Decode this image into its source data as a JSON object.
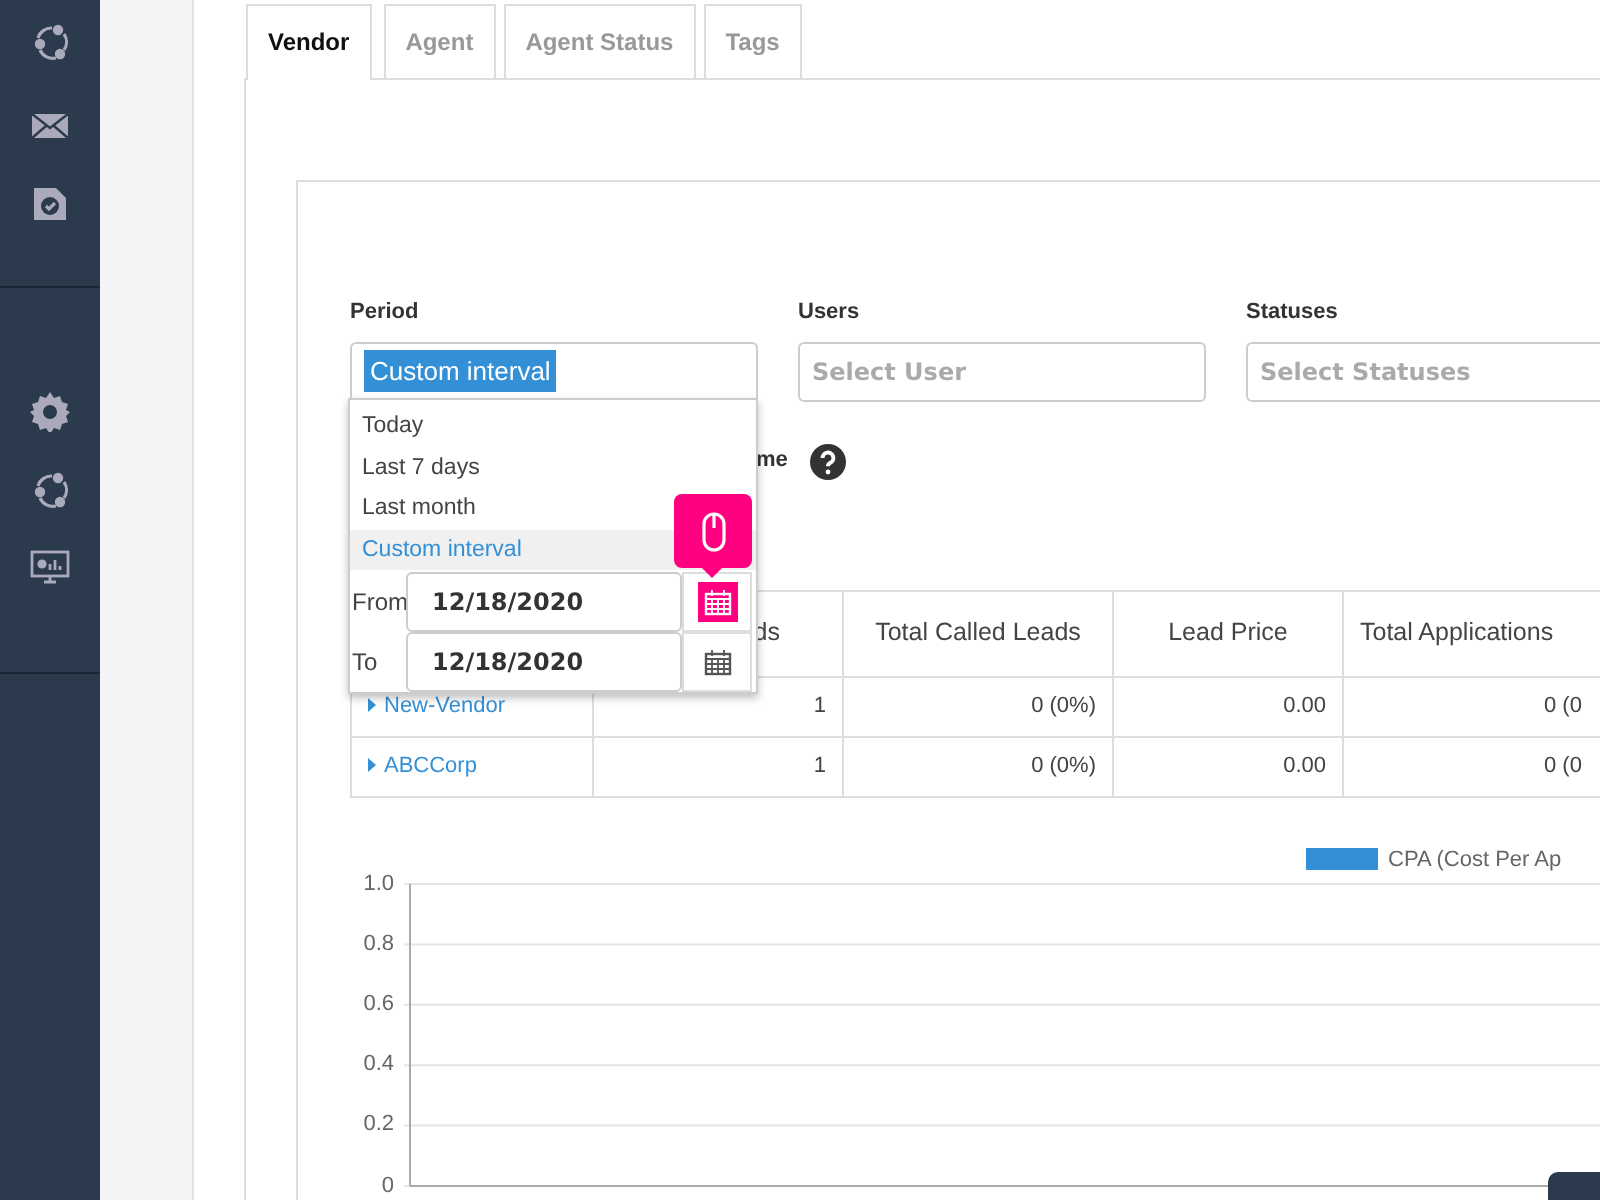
{
  "tabs": [
    {
      "label": "Vendor",
      "selected": true
    },
    {
      "label": "Agent",
      "selected": false
    },
    {
      "label": "Agent Status",
      "selected": false
    },
    {
      "label": "Tags",
      "selected": false
    }
  ],
  "filters": [
    {
      "label": "Period",
      "value": "Custom interval"
    },
    {
      "label": "Users",
      "placeholder": "Select User"
    },
    {
      "label": "Statuses",
      "placeholder": "Select Statuses"
    }
  ],
  "period_dropdown": {
    "options": [
      {
        "label": "Today",
        "selected": false
      },
      {
        "label": "Last 7 days",
        "selected": false
      },
      {
        "label": "Last month",
        "selected": false
      },
      {
        "label": "Custom interval",
        "selected": true
      }
    ],
    "from": {
      "label": "From",
      "value": "12/18/2020",
      "highlighted": true
    },
    "to": {
      "label": "To",
      "value": "12/18/2020",
      "highlighted": false
    }
  },
  "group_label": "me",
  "table": {
    "columns": [
      "ds",
      "Total Called Leads",
      "Lead Price",
      "Total Applications"
    ],
    "rows": [
      {
        "vendor": "New-Vendor",
        "cells": [
          "1",
          "0 (0%)",
          "0.00",
          "0 (0"
        ]
      },
      {
        "vendor": "ABCCorp",
        "cells": [
          "1",
          "0 (0%)",
          "0.00",
          "0 (0"
        ]
      }
    ]
  },
  "chart_data": {
    "type": "bar",
    "grid": true,
    "series": [
      {
        "name": "CPA (Cost Per Ap",
        "color": "#3490d6"
      }
    ],
    "ylim": [
      0,
      1
    ],
    "yticks": [
      {
        "value": 0,
        "label": "0"
      },
      {
        "value": 0.2,
        "label": "0.2"
      },
      {
        "value": 0.4,
        "label": "0.4"
      },
      {
        "value": 0.6,
        "label": "0.6"
      },
      {
        "value": 0.8,
        "label": "0.8"
      },
      {
        "value": 1,
        "label": "1.0"
      }
    ]
  }
}
